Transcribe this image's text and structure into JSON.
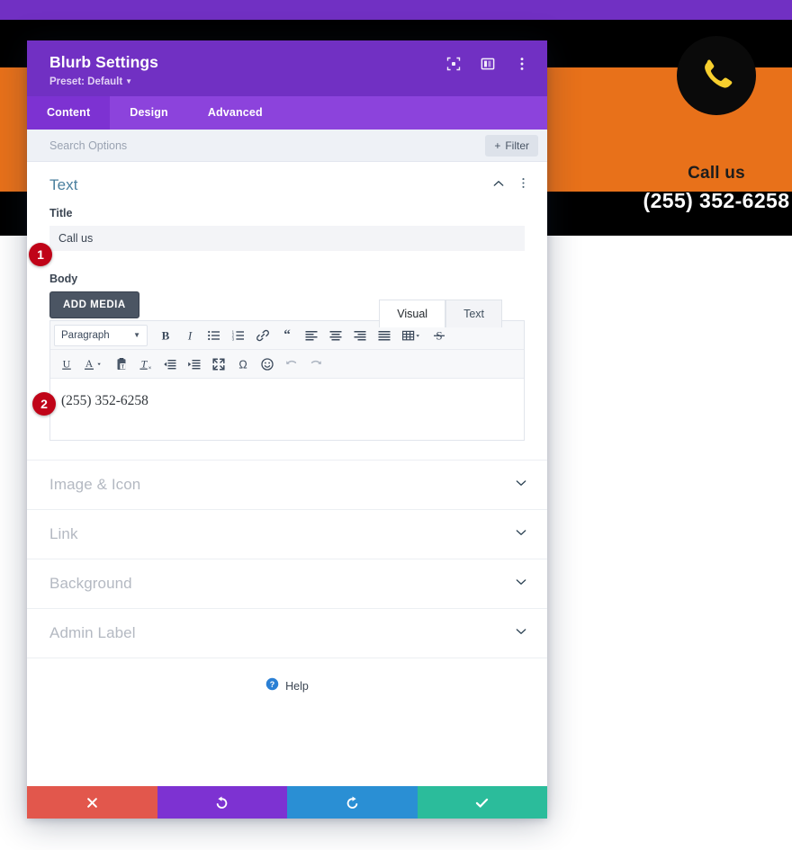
{
  "background": {
    "blurb": {
      "icon": "phone-icon",
      "icon_color": "#f7cf2e",
      "circle_color": "#0a0a0a",
      "title": "Call us",
      "phone": "(255) 352-6258",
      "band_color": "#e8711a",
      "topbar_color": "#7130c3"
    }
  },
  "modal": {
    "title": "Blurb Settings",
    "preset_label": "Preset: Default",
    "header_color": "#7130c3",
    "header_icons": [
      {
        "name": "fullscreen-icon"
      },
      {
        "name": "layout-columns-icon"
      },
      {
        "name": "more-vertical-icon"
      }
    ],
    "tabs": [
      {
        "label": "Content",
        "active": true
      },
      {
        "label": "Design",
        "active": false
      },
      {
        "label": "Advanced",
        "active": false
      }
    ],
    "search": {
      "placeholder": "Search Options",
      "value": "",
      "filter_label": "Filter",
      "filter_icon": "plus-icon"
    },
    "sections": {
      "text": {
        "title": "Text",
        "expanded": true,
        "collapse_icon": "chevron-up-icon",
        "menu_icon": "more-vertical-icon",
        "title_field": {
          "label": "Title",
          "value": "Call us"
        },
        "body_field": {
          "label": "Body",
          "add_media_label": "ADD MEDIA",
          "editor_tabs": [
            {
              "label": "Visual",
              "active": true
            },
            {
              "label": "Text",
              "active": false
            }
          ],
          "content": "(255) 352-6258",
          "toolbar_row1": [
            {
              "name": "paragraph-format-select",
              "label": "Paragraph",
              "type": "select"
            },
            {
              "name": "bold-icon",
              "label": "B"
            },
            {
              "name": "italic-icon",
              "label": "I"
            },
            {
              "name": "bulleted-list-icon"
            },
            {
              "name": "numbered-list-icon"
            },
            {
              "name": "link-icon"
            },
            {
              "name": "blockquote-icon"
            },
            {
              "name": "align-left-icon"
            },
            {
              "name": "align-center-icon"
            },
            {
              "name": "align-right-icon"
            },
            {
              "name": "align-justify-icon"
            },
            {
              "name": "table-icon"
            },
            {
              "name": "strikethrough-icon"
            }
          ],
          "toolbar_row2": [
            {
              "name": "underline-icon"
            },
            {
              "name": "text-color-icon"
            },
            {
              "name": "paste-as-text-icon"
            },
            {
              "name": "clear-formatting-icon"
            },
            {
              "name": "outdent-icon"
            },
            {
              "name": "indent-icon"
            },
            {
              "name": "fullscreen-expand-icon"
            },
            {
              "name": "special-character-icon"
            },
            {
              "name": "emoji-icon"
            },
            {
              "name": "undo-icon"
            },
            {
              "name": "redo-icon"
            }
          ]
        }
      },
      "collapsed": [
        {
          "title": "Image & Icon",
          "icon": "chevron-down-icon"
        },
        {
          "title": "Link",
          "icon": "chevron-down-icon"
        },
        {
          "title": "Background",
          "icon": "chevron-down-icon"
        },
        {
          "title": "Admin Label",
          "icon": "chevron-down-icon"
        }
      ]
    },
    "help": {
      "label": "Help",
      "icon": "help-circle-icon"
    },
    "footer": [
      {
        "name": "cancel-button",
        "icon": "close-icon",
        "color": "#e2574c"
      },
      {
        "name": "undo-button",
        "icon": "undo-icon",
        "color": "#7d32d2"
      },
      {
        "name": "redo-button",
        "icon": "redo-icon",
        "color": "#2a8fd4"
      },
      {
        "name": "save-button",
        "icon": "check-icon",
        "color": "#2bbc9b"
      }
    ]
  },
  "annotations": [
    {
      "number": "1",
      "target": "title-input"
    },
    {
      "number": "2",
      "target": "body-editor"
    }
  ]
}
